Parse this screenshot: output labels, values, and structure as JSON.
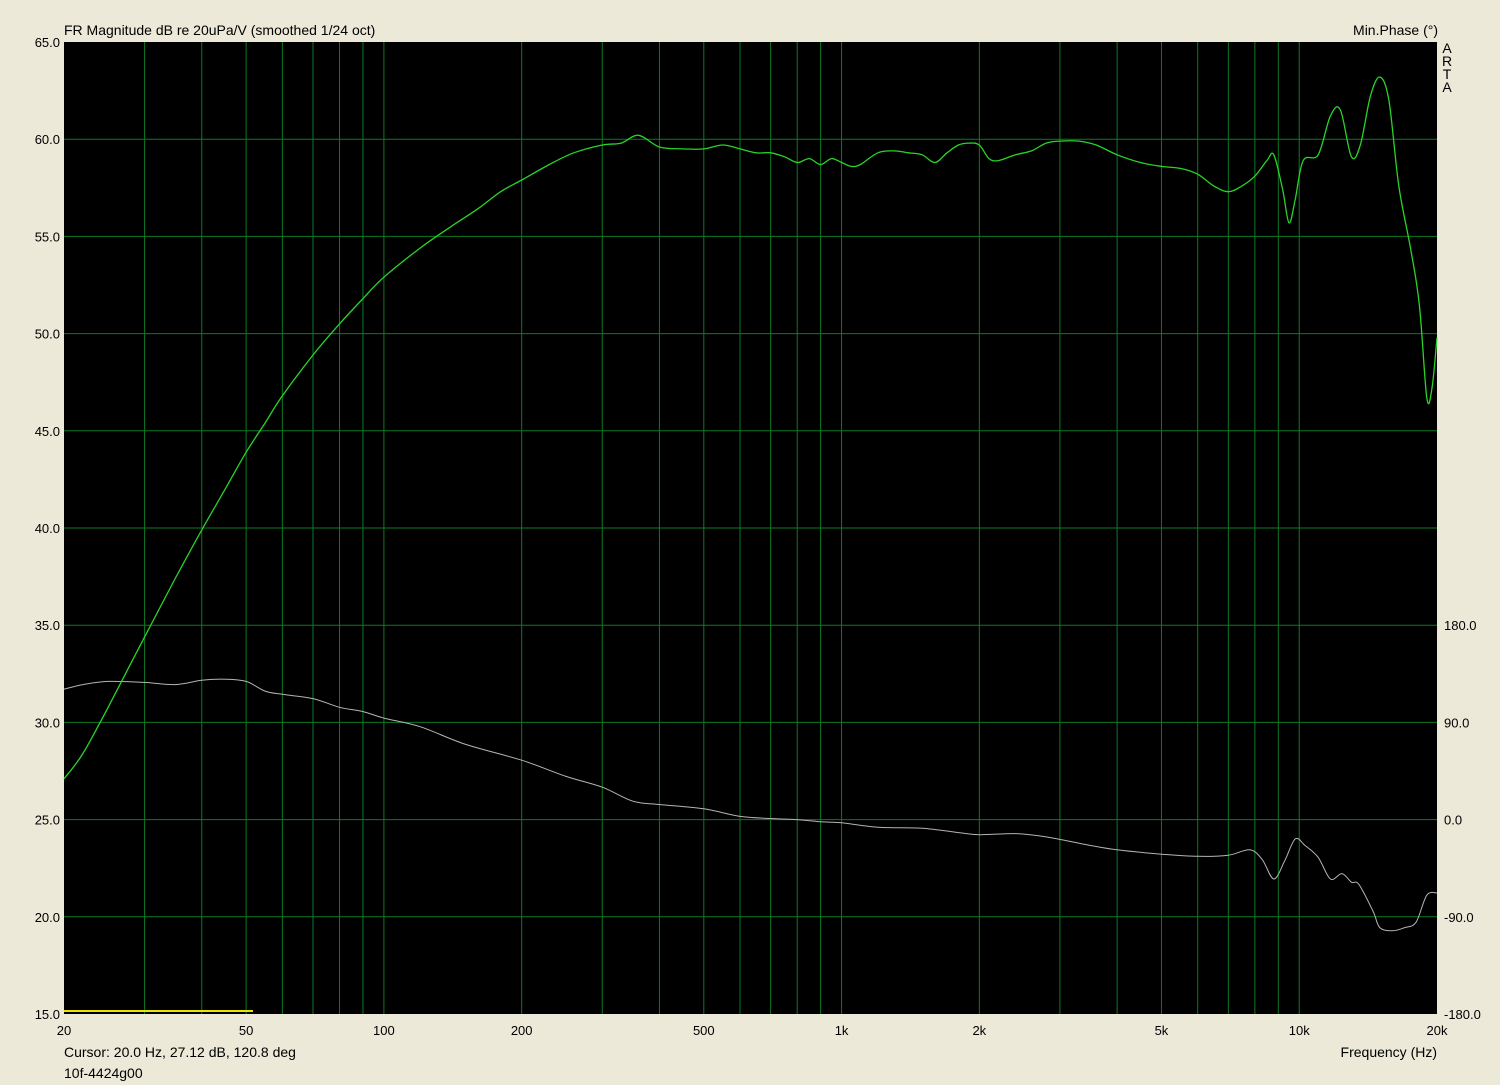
{
  "header": {
    "title": "FR Magnitude dB re 20uPa/V (smoothed 1/24 oct)",
    "right_axis_title": "Min.Phase (°)",
    "watermark": [
      "A",
      "R",
      "T",
      "A"
    ]
  },
  "footer": {
    "cursor": "Cursor: 20.0 Hz, 27.12 dB, 120.8 deg",
    "file": "10f-4424g00",
    "xlabel": "Frequency (Hz)"
  },
  "colors": {
    "background": "#ece9d8",
    "plot_bg": "#000000",
    "grid": "#0d7a23",
    "magnitude": "#28d428",
    "phase": "#b4b4b4",
    "marker": "#e6e600"
  },
  "chart_data": {
    "type": "line",
    "x_scale": "log",
    "xlim": [
      20,
      20000
    ],
    "ylim": [
      15,
      65
    ],
    "y2lim": [
      -180,
      720
    ],
    "yticks": [
      "15.0",
      "20.0",
      "25.0",
      "30.0",
      "35.0",
      "40.0",
      "45.0",
      "50.0",
      "55.0",
      "60.0",
      "65.0"
    ],
    "y2ticks": [
      "-180.0",
      "-90.0",
      "0.0",
      "90.0",
      "180.0"
    ],
    "xticks": [
      {
        "value": 20,
        "label": "20"
      },
      {
        "value": 50,
        "label": "50"
      },
      {
        "value": 100,
        "label": "100"
      },
      {
        "value": 200,
        "label": "200"
      },
      {
        "value": 500,
        "label": "500"
      },
      {
        "value": 1000,
        "label": "1k"
      },
      {
        "value": 2000,
        "label": "2k"
      },
      {
        "value": 5000,
        "label": "5k"
      },
      {
        "value": 10000,
        "label": "10k"
      },
      {
        "value": 20000,
        "label": "20k"
      }
    ],
    "grid": true,
    "series": [
      {
        "name": "FR Magnitude",
        "axis": "left",
        "points": [
          [
            20,
            27.1
          ],
          [
            22,
            28.4
          ],
          [
            25,
            30.8
          ],
          [
            30,
            34.4
          ],
          [
            35,
            37.4
          ],
          [
            40,
            39.9
          ],
          [
            45,
            42.0
          ],
          [
            50,
            43.9
          ],
          [
            55,
            45.4
          ],
          [
            60,
            46.8
          ],
          [
            70,
            48.9
          ],
          [
            80,
            50.5
          ],
          [
            90,
            51.8
          ],
          [
            100,
            52.9
          ],
          [
            120,
            54.4
          ],
          [
            140,
            55.5
          ],
          [
            160,
            56.4
          ],
          [
            180,
            57.3
          ],
          [
            200,
            57.9
          ],
          [
            230,
            58.7
          ],
          [
            260,
            59.3
          ],
          [
            300,
            59.7
          ],
          [
            330,
            59.8
          ],
          [
            360,
            60.2
          ],
          [
            400,
            59.6
          ],
          [
            450,
            59.5
          ],
          [
            500,
            59.5
          ],
          [
            550,
            59.7
          ],
          [
            600,
            59.5
          ],
          [
            650,
            59.3
          ],
          [
            700,
            59.3
          ],
          [
            750,
            59.1
          ],
          [
            800,
            58.8
          ],
          [
            850,
            59.0
          ],
          [
            900,
            58.7
          ],
          [
            950,
            59.0
          ],
          [
            1000,
            58.8
          ],
          [
            1050,
            58.6
          ],
          [
            1100,
            58.7
          ],
          [
            1200,
            59.3
          ],
          [
            1300,
            59.4
          ],
          [
            1400,
            59.3
          ],
          [
            1500,
            59.2
          ],
          [
            1600,
            58.8
          ],
          [
            1700,
            59.3
          ],
          [
            1800,
            59.7
          ],
          [
            1900,
            59.8
          ],
          [
            2000,
            59.7
          ],
          [
            2100,
            59.0
          ],
          [
            2200,
            58.9
          ],
          [
            2400,
            59.2
          ],
          [
            2600,
            59.4
          ],
          [
            2800,
            59.8
          ],
          [
            3000,
            59.9
          ],
          [
            3300,
            59.9
          ],
          [
            3600,
            59.7
          ],
          [
            4000,
            59.2
          ],
          [
            4500,
            58.8
          ],
          [
            5000,
            58.6
          ],
          [
            5500,
            58.5
          ],
          [
            6000,
            58.2
          ],
          [
            6500,
            57.6
          ],
          [
            7000,
            57.3
          ],
          [
            7500,
            57.6
          ],
          [
            8000,
            58.1
          ],
          [
            8500,
            58.9
          ],
          [
            8800,
            59.2
          ],
          [
            9200,
            57.4
          ],
          [
            9500,
            55.7
          ],
          [
            9800,
            56.9
          ],
          [
            10200,
            58.9
          ],
          [
            11000,
            59.2
          ],
          [
            11700,
            61.2
          ],
          [
            12300,
            61.5
          ],
          [
            13000,
            59.1
          ],
          [
            13600,
            59.7
          ],
          [
            14300,
            62.2
          ],
          [
            15000,
            63.2
          ],
          [
            15700,
            62.0
          ],
          [
            16500,
            57.6
          ],
          [
            17500,
            54.4
          ],
          [
            18300,
            51.5
          ],
          [
            19000,
            46.7
          ],
          [
            19500,
            47.2
          ],
          [
            20000,
            49.8
          ]
        ]
      },
      {
        "name": "Min.Phase",
        "axis": "right",
        "points": [
          [
            20,
            120.8
          ],
          [
            22,
            125
          ],
          [
            25,
            128
          ],
          [
            30,
            127
          ],
          [
            35,
            125
          ],
          [
            40,
            129
          ],
          [
            45,
            130
          ],
          [
            50,
            128
          ],
          [
            55,
            119
          ],
          [
            60,
            116
          ],
          [
            70,
            112
          ],
          [
            80,
            104
          ],
          [
            90,
            100
          ],
          [
            100,
            94
          ],
          [
            120,
            86
          ],
          [
            150,
            70
          ],
          [
            200,
            55
          ],
          [
            250,
            40
          ],
          [
            300,
            30
          ],
          [
            350,
            17
          ],
          [
            400,
            14
          ],
          [
            500,
            10
          ],
          [
            600,
            3
          ],
          [
            700,
            1
          ],
          [
            800,
            0
          ],
          [
            900,
            -2
          ],
          [
            1000,
            -3
          ],
          [
            1200,
            -7
          ],
          [
            1500,
            -8
          ],
          [
            1800,
            -12
          ],
          [
            2000,
            -14
          ],
          [
            2400,
            -13
          ],
          [
            2800,
            -16
          ],
          [
            3500,
            -24
          ],
          [
            4000,
            -28
          ],
          [
            5000,
            -32
          ],
          [
            6000,
            -34
          ],
          [
            7000,
            -33
          ],
          [
            7800,
            -28
          ],
          [
            8300,
            -37
          ],
          [
            8800,
            -55
          ],
          [
            9300,
            -38
          ],
          [
            9800,
            -18
          ],
          [
            10300,
            -24
          ],
          [
            11000,
            -35
          ],
          [
            11700,
            -55
          ],
          [
            12400,
            -50
          ],
          [
            13000,
            -58
          ],
          [
            13500,
            -60
          ],
          [
            14500,
            -85
          ],
          [
            15000,
            -100
          ],
          [
            16000,
            -103
          ],
          [
            17000,
            -100
          ],
          [
            18000,
            -95
          ],
          [
            19000,
            -70
          ],
          [
            20000,
            -68
          ]
        ]
      }
    ]
  }
}
